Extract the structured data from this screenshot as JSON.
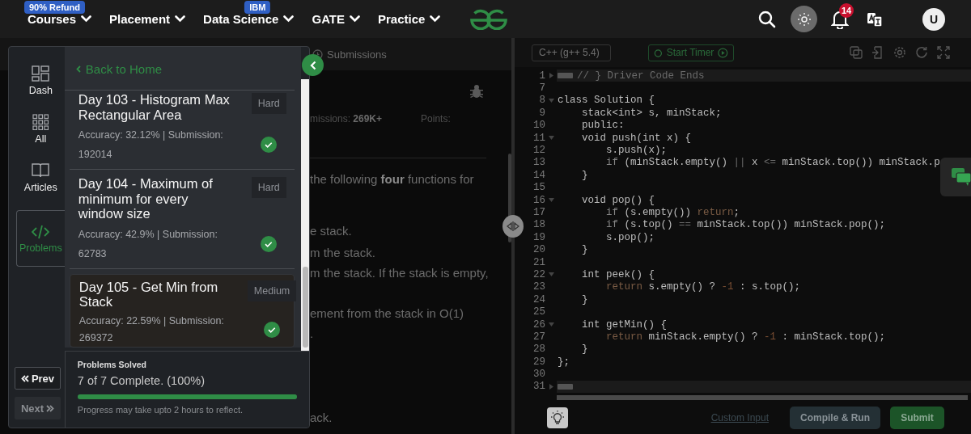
{
  "nav": {
    "items": [
      {
        "label": "Courses",
        "badge": "90% Refund"
      },
      {
        "label": "Placement"
      },
      {
        "label": "Data Science",
        "badge": "IBM"
      },
      {
        "label": "GATE"
      },
      {
        "label": "Practice"
      }
    ],
    "notification_count": "14",
    "avatar_initial": "U"
  },
  "problem_view": {
    "tabs": [
      {
        "label": "Submissions"
      }
    ],
    "stats": [
      {
        "label": "missions:",
        "value": "269K+"
      },
      {
        "label": "Points:"
      }
    ],
    "description_lines": [
      "the following **four** functions for",
      "e stack.",
      "m the stack.",
      "m the stack. If the stack is empty,",
      "ement from the stack in O(1)",
      ".",
      "ack."
    ]
  },
  "editor": {
    "language": "C++ (g++ 5.4)",
    "timer_label": "Start Timer",
    "lines": [
      {
        "number": "1",
        "folded": true,
        "segments": [
          {
            "text": "// } Driver Code Ends",
            "kind": "comment"
          }
        ]
      },
      {
        "number": "7"
      },
      {
        "number": "8",
        "folded": false,
        "segments": [
          {
            "text": "class Solution {",
            "kind": "plain"
          }
        ]
      },
      {
        "number": "9",
        "segments": [
          {
            "text": "    stack<int> s, minStack;",
            "kind": "plain"
          }
        ]
      },
      {
        "number": "10",
        "segments": [
          {
            "text": "    public:",
            "kind": "plain"
          }
        ]
      },
      {
        "number": "11",
        "folded": false,
        "segments": [
          {
            "text": "    void push(int x) {",
            "kind": "plain"
          }
        ]
      },
      {
        "number": "12",
        "segments": [
          {
            "text": "        s.push(x);",
            "kind": "plain"
          }
        ]
      },
      {
        "number": "13",
        "segments": [
          {
            "text": "        if",
            "kind": "keyword"
          },
          {
            "text": " (minStack.empty() ",
            "kind": "plain"
          },
          {
            "text": "||",
            "kind": "operator"
          },
          {
            "text": " x ",
            "kind": "plain"
          },
          {
            "text": "<=",
            "kind": "operator"
          },
          {
            "text": " minStack.top()) minStack.p",
            "kind": "plain"
          }
        ]
      },
      {
        "number": "14",
        "segments": [
          {
            "text": "    }",
            "kind": "plain"
          }
        ]
      },
      {
        "number": "15"
      },
      {
        "number": "16",
        "folded": false,
        "segments": [
          {
            "text": "    void pop() {",
            "kind": "plain"
          }
        ]
      },
      {
        "number": "17",
        "segments": [
          {
            "text": "        if",
            "kind": "keyword"
          },
          {
            "text": " (s.empty()) ",
            "kind": "plain"
          },
          {
            "text": "return",
            "kind": "return"
          },
          {
            "text": ";",
            "kind": "plain"
          }
        ]
      },
      {
        "number": "18",
        "segments": [
          {
            "text": "        if",
            "kind": "keyword"
          },
          {
            "text": " (s.top() ",
            "kind": "plain"
          },
          {
            "text": "==",
            "kind": "operator"
          },
          {
            "text": " minStack.top()) minStack.pop();",
            "kind": "plain"
          }
        ]
      },
      {
        "number": "19",
        "segments": [
          {
            "text": "        s.pop();",
            "kind": "plain"
          }
        ]
      },
      {
        "number": "20",
        "segments": [
          {
            "text": "    }",
            "kind": "plain"
          }
        ]
      },
      {
        "number": "21"
      },
      {
        "number": "22",
        "folded": false,
        "segments": [
          {
            "text": "    int peek() {",
            "kind": "plain"
          }
        ]
      },
      {
        "number": "23",
        "segments": [
          {
            "text": "        return",
            "kind": "return"
          },
          {
            "text": " s.empty() ? ",
            "kind": "plain"
          },
          {
            "text": "-1",
            "kind": "number"
          },
          {
            "text": " : s.top();",
            "kind": "plain"
          }
        ]
      },
      {
        "number": "24",
        "segments": [
          {
            "text": "    }",
            "kind": "plain"
          }
        ]
      },
      {
        "number": "25"
      },
      {
        "number": "26",
        "folded": false,
        "segments": [
          {
            "text": "    int getMin() {",
            "kind": "plain"
          }
        ]
      },
      {
        "number": "27",
        "segments": [
          {
            "text": "        return",
            "kind": "return"
          },
          {
            "text": " minStack.empty() ? ",
            "kind": "plain"
          },
          {
            "text": "-1",
            "kind": "number"
          },
          {
            "text": " : minStack.top();",
            "kind": "plain"
          }
        ]
      },
      {
        "number": "28",
        "segments": [
          {
            "text": "    }",
            "kind": "plain"
          }
        ]
      },
      {
        "number": "29",
        "segments": [
          {
            "text": "};",
            "kind": "plain"
          }
        ]
      },
      {
        "number": "30"
      },
      {
        "number": "31",
        "folded": true
      }
    ],
    "custom_input": "Custom Input",
    "buttons": [
      {
        "label": "Compile & Run",
        "kind": "secondary"
      },
      {
        "label": "Submit",
        "kind": "primary"
      }
    ]
  },
  "sidebar": {
    "rail": [
      {
        "label": "Dash",
        "selected": false
      },
      {
        "label": "All",
        "selected": false
      },
      {
        "label": "Articles",
        "selected": false
      },
      {
        "label": "Problems",
        "selected": true
      }
    ],
    "pager": [
      {
        "label": "Prev",
        "disabled": false
      },
      {
        "label": "Next",
        "disabled": true
      }
    ],
    "back_link": "Back to Home",
    "problems": [
      {
        "title": "Day 103 - Histogram Max Rectangular Area",
        "difficulty": "Hard",
        "stats": "Accuracy: 32.12% | Submission: 192014",
        "solved": true,
        "selected": false
      },
      {
        "title": "Day 104 - Maximum of minimum for every window size",
        "difficulty": "Hard",
        "stats": "Accuracy: 42.9% | Submission: 62783",
        "solved": true,
        "selected": false
      },
      {
        "title": "Day 105 - Get Min from Stack",
        "difficulty": "Medium",
        "stats": "Accuracy: 22.59% | Submission: 269372",
        "solved": true,
        "selected": true
      }
    ],
    "progress": {
      "title": "Problems Solved",
      "summary": "7 of 7 Complete. (100%)",
      "level": 1,
      "note": "Progress may take upto 2 hours to reflect."
    }
  }
}
